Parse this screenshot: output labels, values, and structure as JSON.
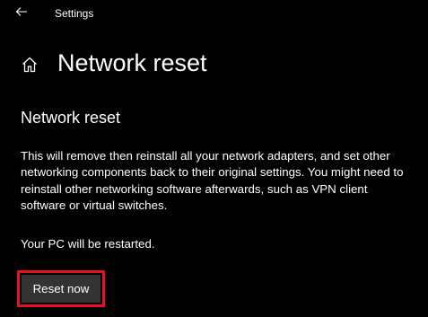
{
  "window": {
    "title": "Settings",
    "back_icon": "back-arrow-icon"
  },
  "header": {
    "home_icon": "home-icon",
    "title": "Network reset"
  },
  "main": {
    "section_title": "Network reset",
    "description": "This will remove then reinstall all your network adapters, and set other networking components back to their original settings. You might need to reinstall other networking software afterwards, such as VPN client software or virtual switches.",
    "restart_note": "Your PC will be restarted.",
    "reset_button_label": "Reset now"
  },
  "colors": {
    "background": "#000000",
    "text": "#ffffff",
    "button_bg": "#333333",
    "highlight": "#e81123"
  }
}
